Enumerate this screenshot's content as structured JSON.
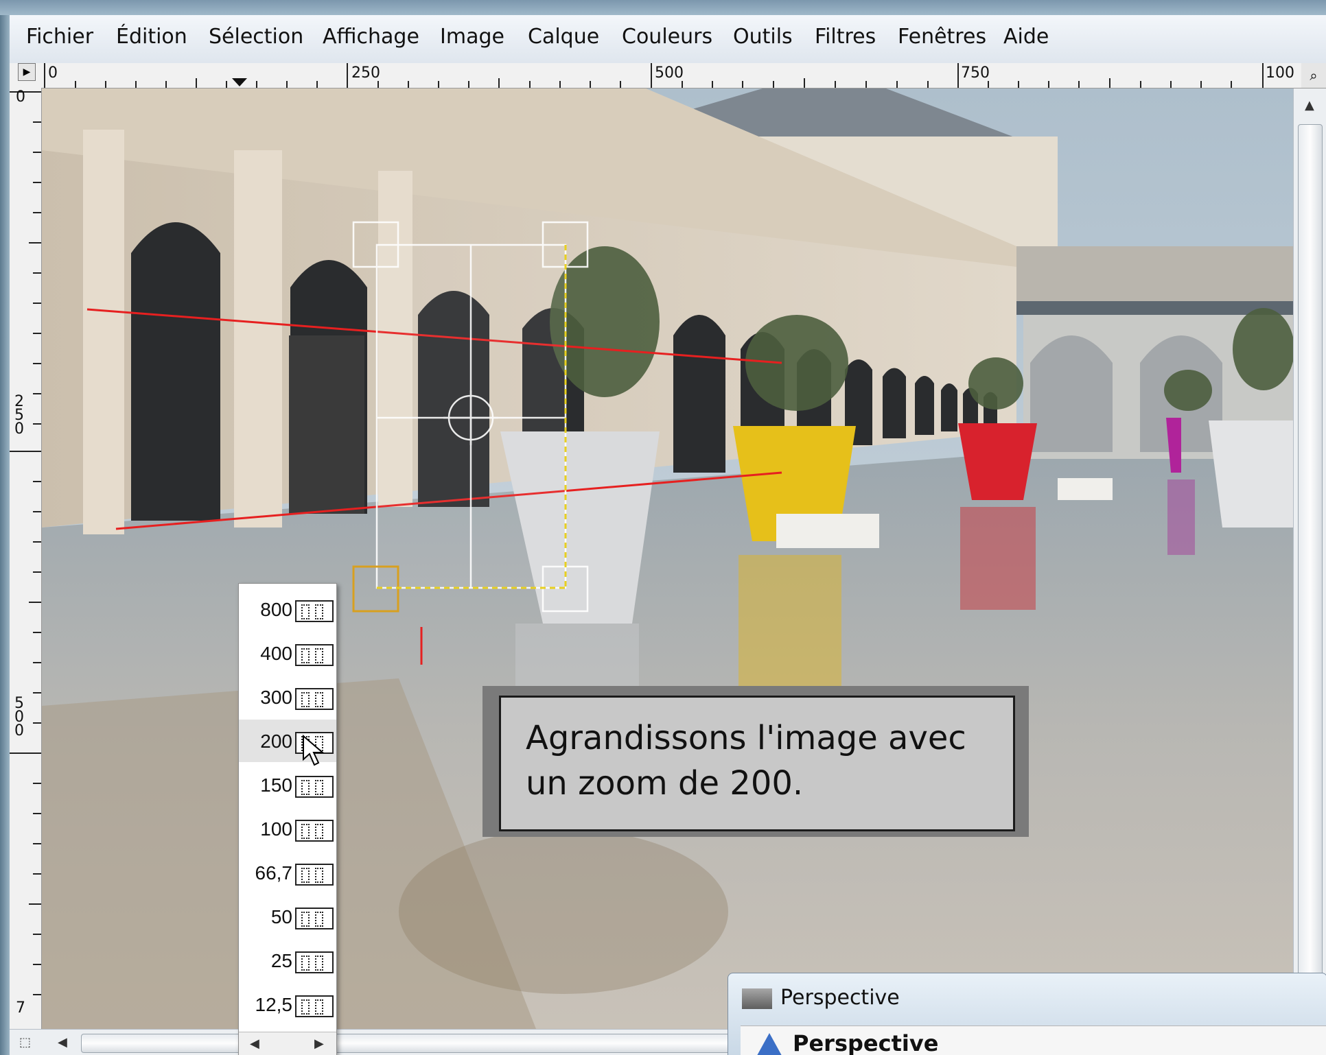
{
  "menubar": {
    "items": [
      "Fichier",
      "Édition",
      "Sélection",
      "Affichage",
      "Image",
      "Calque",
      "Couleurs",
      "Outils",
      "Filtres",
      "Fenêtres",
      "Aide"
    ]
  },
  "rulers": {
    "horizontal_labels": [
      "0",
      "250",
      "500",
      "750",
      "100"
    ],
    "vertical_labels": [
      "0",
      "250",
      "500",
      "7"
    ]
  },
  "zoom_menu": {
    "options": [
      "800",
      "400",
      "300",
      "200",
      "150",
      "100",
      "66,7",
      "50",
      "25",
      "12,5"
    ],
    "highlighted": "200"
  },
  "callout": {
    "line1": "Agrandissons l'image avec",
    "line2": "un zoom de 200."
  },
  "dialog": {
    "title": "Perspective",
    "heading": "Perspective"
  },
  "colors": {
    "guide_line": "#e62020",
    "pot_yellow": "#e6c01a",
    "pot_red": "#d8222d",
    "pot_magenta": "#b0239a",
    "handle_highlight": "#d8a020"
  }
}
